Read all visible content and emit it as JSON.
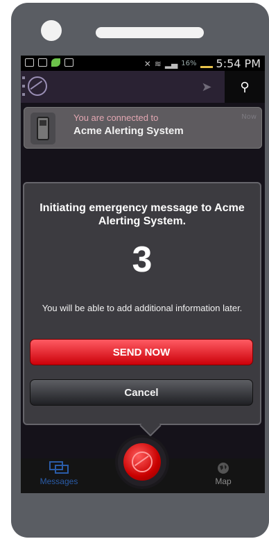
{
  "status_bar": {
    "battery": "16%",
    "time": "5:54 PM"
  },
  "notification": {
    "line1": "You are connected to",
    "line2": "Acme Alerting System",
    "time": "Now"
  },
  "dialog": {
    "title": "Initiating emergency message to Acme Alerting System.",
    "countdown": "3",
    "note": "You will be able to add additional information later.",
    "send_label": "SEND NOW",
    "cancel_label": "Cancel"
  },
  "tabs": {
    "messages": "Messages",
    "map": "Map"
  },
  "colors": {
    "accent_red": "#e0141c",
    "tab_active": "#2a5ca8"
  }
}
